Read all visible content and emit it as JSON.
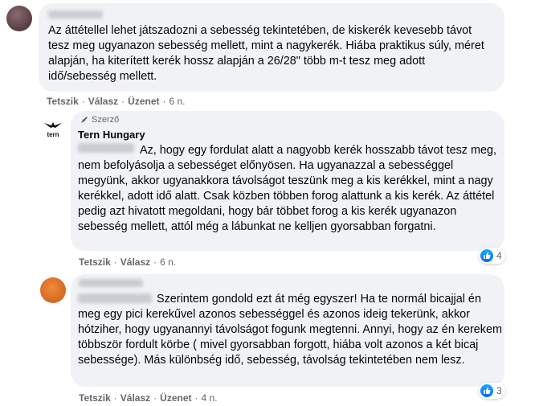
{
  "comments": [
    {
      "text": "Az áttétellel lehet játszadozni a sebesség tekintetében, de kiskerék kevesebb távot tesz meg ugyanazon sebesség mellett, mint a nagykerék. Hiába praktikus súly, méret alapján, ha kiterített kerék hossz alapján a 26/28\" több m-t tesz meg adott idő/sebesség mellett.",
      "actions": {
        "like": "Tetszik",
        "reply": "Válasz",
        "message": "Üzenet",
        "time": "6 n."
      }
    },
    {
      "author_tag": "Szerző",
      "author": "Tern Hungary",
      "avatar_logo": "tern",
      "text": "Az, hogy egy fordulat alatt a nagyobb kerék hosszabb távot tesz meg, nem befolyásolja a sebességet előnyösen. Ha ugyanazzal a sebességgel megyünk, akkor ugyanakkora távolságot teszünk meg a kis kerékkel, mint a nagy kerékkel, adott idő alatt. Csak közben többen forog alattunk a kis kerék. Az áttétel pedig azt hivatott megoldani, hogy bár többet forog a kis kerék ugyanazon sebesség mellett, attól még a lábunkat ne kelljen gyorsabban forgatni.",
      "actions": {
        "like": "Tetszik",
        "reply": "Válasz",
        "time": "6 n."
      },
      "reactions": "4"
    },
    {
      "text": "Szerintem gondold ezt át még egyszer! Ha te normál bicajjal én meg egy pici kerekűvel azonos sebességgel és azonos ideig tekerünk, akkor hótziher, hogy ugyanannyi távolságot fogunk megtenni. Annyi, hogy az én kerekem többször fordult körbe ( mivel gyorsabban forgott, hiába volt azonos a két bicaj sebessége). Más különbség idő, sebesség, távolság tekintetében nem lesz.",
      "actions": {
        "like": "Tetszik",
        "reply": "Válasz",
        "message": "Üzenet",
        "time": "4 n."
      },
      "reactions": "3"
    }
  ],
  "colors": {
    "bubble": "#f0f2f5",
    "secondary_text": "#65676b",
    "like_blue": "#0866ff",
    "avatar_orange": "#e8702a",
    "avatar_dark": "#5a3e40"
  },
  "icons": {
    "author_badge": "quill-icon",
    "reaction": "thumbs-up-icon"
  }
}
